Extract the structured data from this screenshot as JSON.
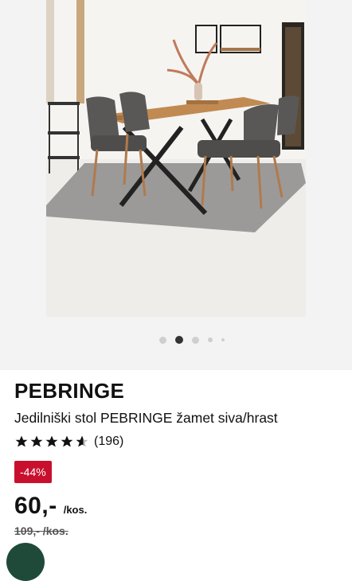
{
  "gallery": {
    "image_alt": "PEBRINGE dining table with grey velvet chairs",
    "dots": [
      {
        "active": false,
        "size": "normal"
      },
      {
        "active": true,
        "size": "normal"
      },
      {
        "active": false,
        "size": "normal"
      },
      {
        "active": false,
        "size": "small"
      },
      {
        "active": false,
        "size": "tiny"
      }
    ]
  },
  "product": {
    "brand": "PEBRINGE",
    "title": "Jedilniški stol PEBRINGE žamet siva/hrast",
    "rating_stars": 4.5,
    "rating_count": "(196)",
    "discount_badge": "-44%",
    "price": "60,-",
    "price_unit": "/kos.",
    "old_price": "109,- /kos."
  },
  "colors": {
    "accent_red": "#c8102e",
    "fab_green": "#1f4a3a"
  }
}
